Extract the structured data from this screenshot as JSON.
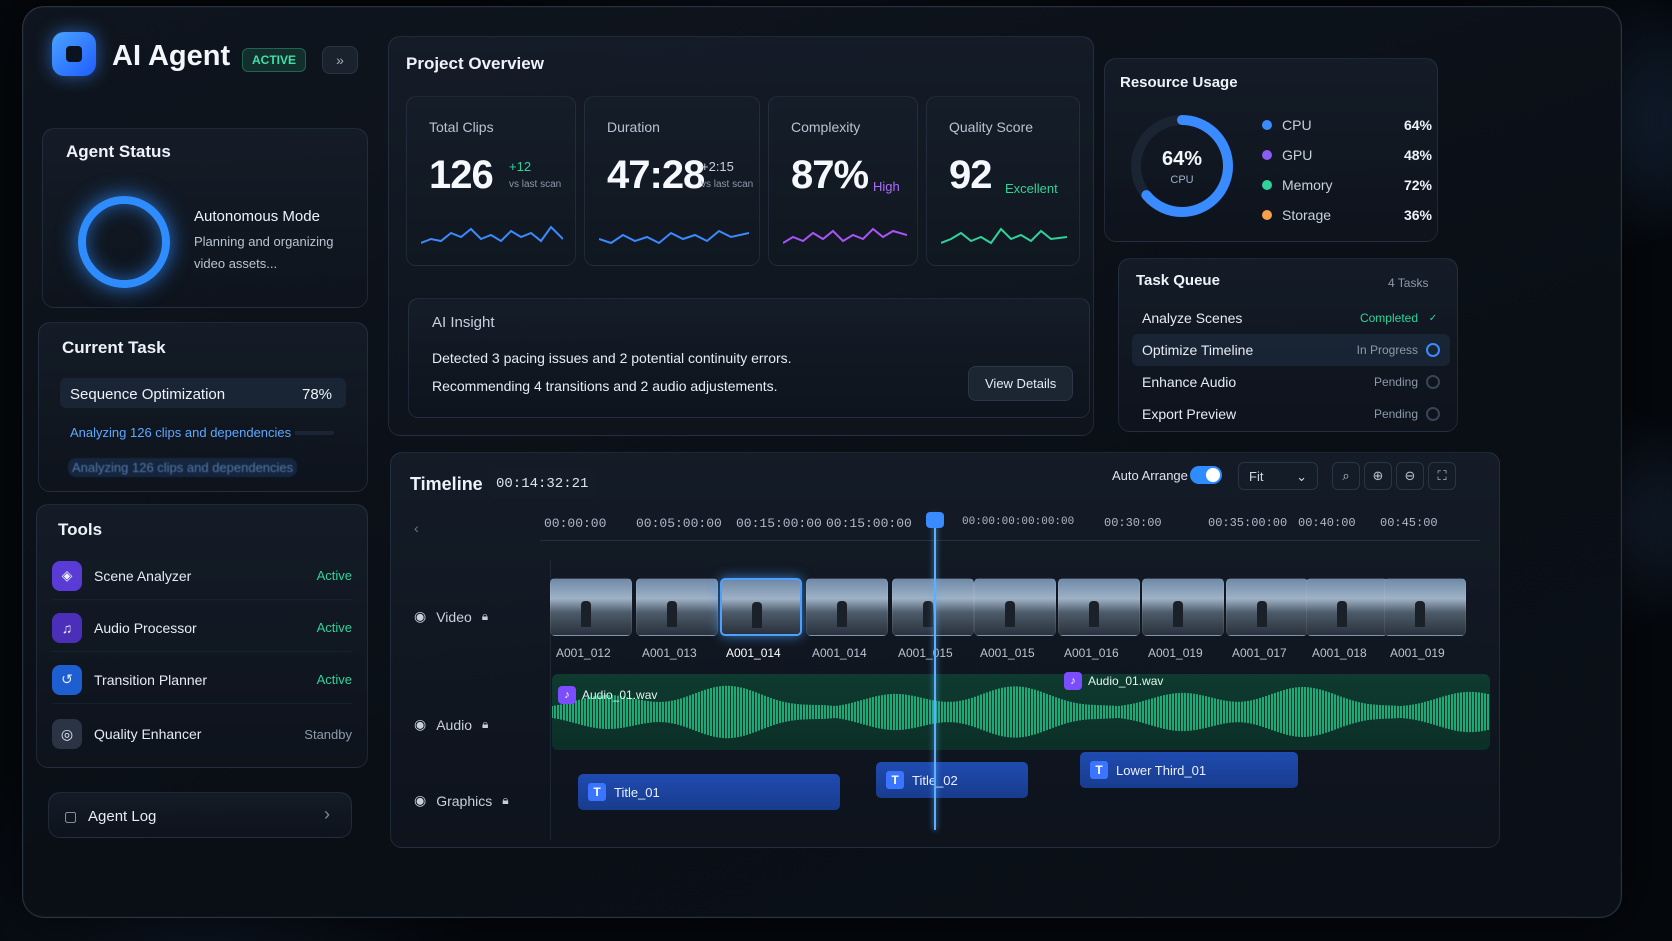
{
  "header": {
    "app_title": "AI Agent",
    "status_badge": "ACTIVE"
  },
  "agent_status": {
    "title": "Agent Status",
    "mode": "Autonomous Mode",
    "description_line1": "Planning and organizing",
    "description_line2": "video assets..."
  },
  "current_task": {
    "title": "Current Task",
    "name": "Sequence Optimization",
    "percent_label": "78%",
    "progress": 0.78,
    "detail": "Analyzing 126 clips and dependencies",
    "detail_ghost": "Analyzing 126 clips and dependencies"
  },
  "tools": {
    "title": "Tools",
    "items": [
      {
        "name": "Scene Analyzer",
        "status": "Active"
      },
      {
        "name": "Audio Processor",
        "status": "Active"
      },
      {
        "name": "Transition Planner",
        "status": "Active"
      },
      {
        "name": "Quality Enhancer",
        "status": "Standby"
      }
    ],
    "agent_log": "Agent Log"
  },
  "overview": {
    "title": "Project Overview",
    "cards": [
      {
        "label": "Total Clips",
        "value": "126",
        "delta": "+12",
        "sub": "vs last scan"
      },
      {
        "label": "Duration",
        "value": "47:28",
        "delta": "+2:15",
        "sub": "vs last scan"
      },
      {
        "label": "Complexity",
        "value": "87%",
        "delta": "High"
      },
      {
        "label": "Quality Score",
        "value": "92",
        "delta": "Excellent"
      }
    ]
  },
  "insight": {
    "title": "AI Insight",
    "line1": "Detected 3 pacing issues and 2 potential continuity errors.",
    "line2": "Recommending 4 transitions and 2 audio adjustements.",
    "button": "View Details"
  },
  "resources": {
    "title": "Resource Usage",
    "gauge_value": "64%",
    "gauge_label": "CPU",
    "gauge_fraction": 0.64,
    "items": [
      {
        "name": "CPU",
        "value": "64%",
        "color": "#3a8bff"
      },
      {
        "name": "GPU",
        "value": "48%",
        "color": "#8b5cf6"
      },
      {
        "name": "Memory",
        "value": "72%",
        "color": "#2fd39a"
      },
      {
        "name": "Storage",
        "value": "36%",
        "color": "#f5a04a"
      }
    ]
  },
  "task_queue": {
    "title": "Task Queue",
    "count": "4 Tasks",
    "items": [
      {
        "name": "Analyze Scenes",
        "status": "Completed"
      },
      {
        "name": "Optimize Timeline",
        "status": "In Progress"
      },
      {
        "name": "Enhance Audio",
        "status": "Pending"
      },
      {
        "name": "Export Preview",
        "status": "Pending"
      }
    ]
  },
  "timeline": {
    "title": "Timeline",
    "timecode": "00:14:32:21",
    "auto_arrange": "Auto Arrange",
    "zoom_select": "Fit",
    "ruler": [
      "00:00:00",
      "00:05:00:00",
      "00:15:00:00",
      "00:15:00:00",
      "00:00:00:00:00:00",
      "00:30:00",
      "00:35:00:00",
      "00:40:00",
      "00:45:00"
    ],
    "tracks": {
      "video": "Video",
      "audio": "Audio",
      "graphics": "Graphics"
    },
    "video_clips": [
      "A001_012",
      "A001_013",
      "A001_014",
      "A001_014",
      "A001_015",
      "A001_015",
      "A001_016",
      "A001_019",
      "A001_017",
      "A001_018",
      "A001_019"
    ],
    "audio_clips": [
      "Audio_01.wav",
      "Audio_01.wav"
    ],
    "graphics_clips": [
      "Title_01",
      "Title_02",
      "Lower Third_01"
    ]
  },
  "colors": {
    "accent": "#2f8cff",
    "success": "#2fd39a",
    "purple": "#a855f7",
    "audio": "#1fc98a"
  },
  "icons": {
    "logo": "agent-logo-icon",
    "tools": [
      "scene-analyzer-icon",
      "audio-processor-icon",
      "transition-planner-icon",
      "quality-enhancer-icon"
    ]
  }
}
